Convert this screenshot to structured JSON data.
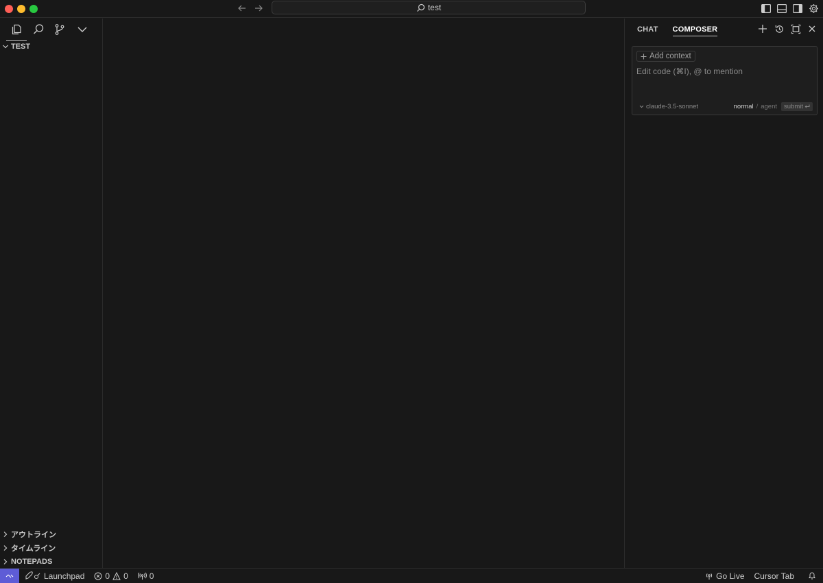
{
  "titlebar": {
    "search_text": "test"
  },
  "sidebar": {
    "folder_name": "TEST",
    "sections": {
      "outline": "アウトライン",
      "timeline": "タイムライン",
      "notepads": "NOTEPADS"
    }
  },
  "panel": {
    "tabs": [
      {
        "label": "CHAT",
        "active": false
      },
      {
        "label": "COMPOSER",
        "active": true
      }
    ],
    "add_context_label": "Add context",
    "input_placeholder": "Edit code (⌘I), @ to mention",
    "model": "claude-3.5-sonnet",
    "mode_normal": "normal",
    "mode_separator": "/",
    "mode_agent": "agent",
    "submit_label": "submit"
  },
  "statusbar": {
    "launchpad_label": "Launchpad",
    "errors": "0",
    "warnings": "0",
    "ports": "0",
    "go_live_label": "Go Live",
    "cursor_tab_label": "Cursor Tab"
  },
  "colors": {
    "background": "#181818",
    "remote_accent": "#5e5cd6",
    "close_red": "#ff5f57",
    "minimize_yellow": "#febc2e",
    "zoom_green": "#28c840"
  }
}
